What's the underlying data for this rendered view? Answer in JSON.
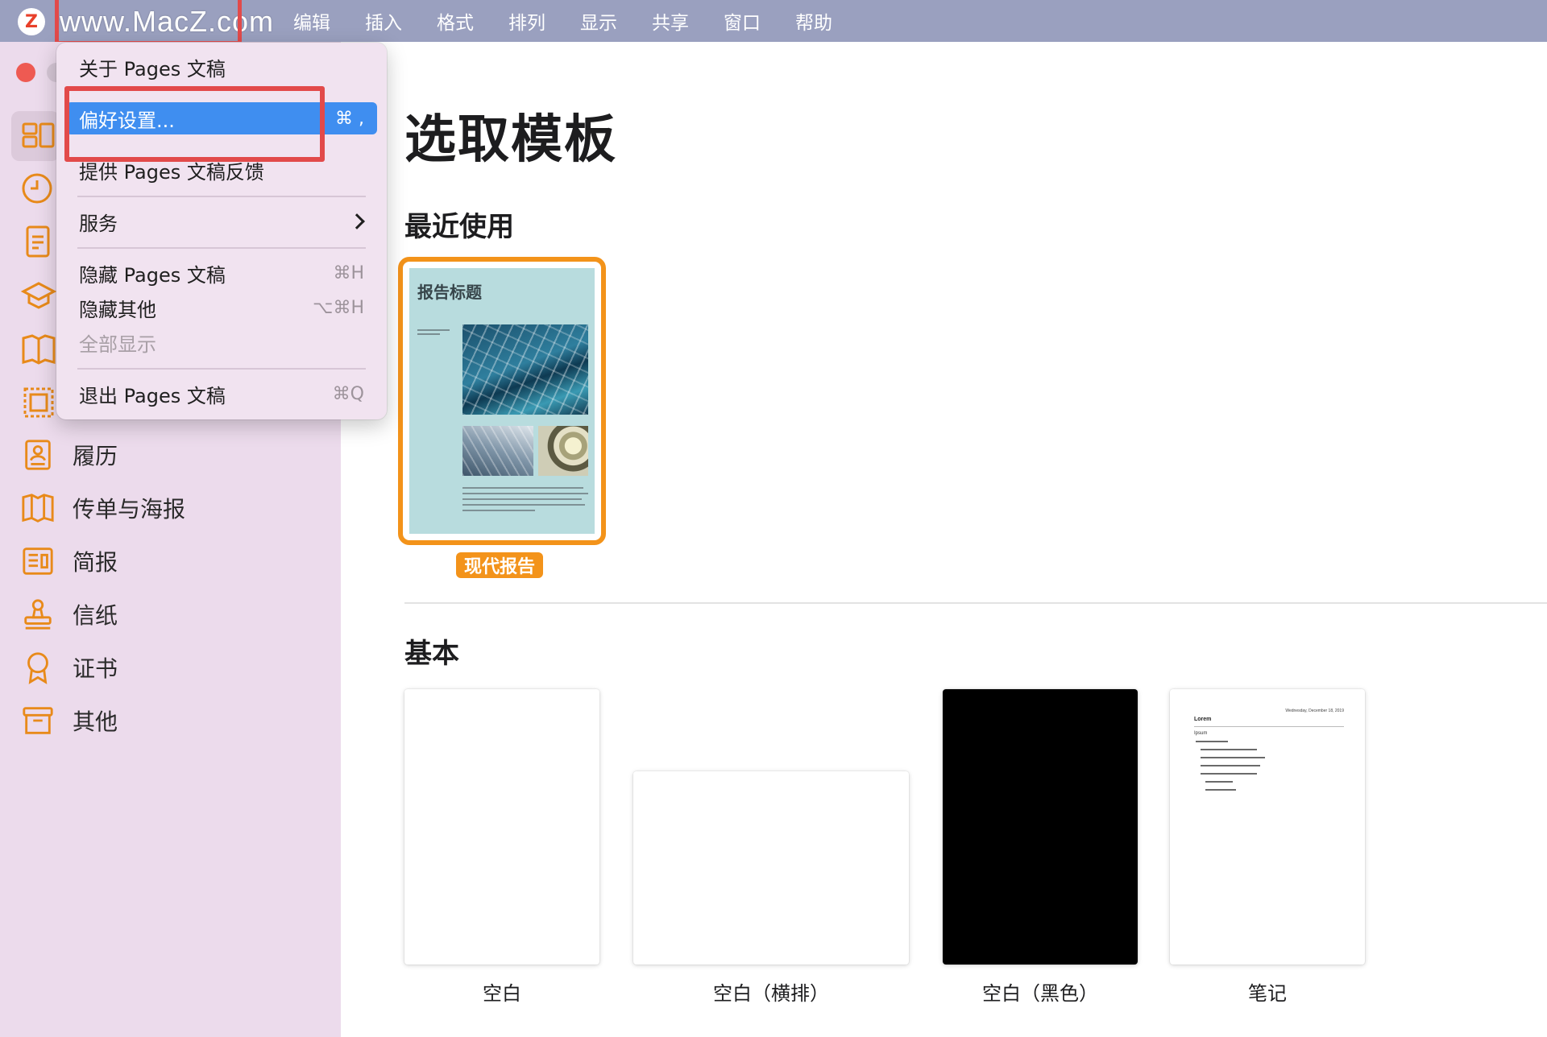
{
  "menubar": {
    "watermark": "www.MacZ.com",
    "menus": [
      "编辑",
      "插入",
      "格式",
      "排列",
      "显示",
      "共享",
      "窗口",
      "帮助"
    ]
  },
  "dropdown": {
    "about": "关于 Pages 文稿",
    "preferences": "偏好设置...",
    "preferences_shortcut": "⌘ ,",
    "feedback": "提供 Pages 文稿反馈",
    "services": "服务",
    "hide_pages": "隐藏 Pages 文稿",
    "hide_pages_shortcut": "⌘H",
    "hide_others": "隐藏其他",
    "hide_others_shortcut": "⌥⌘H",
    "show_all": "全部显示",
    "quit": "退出 Pages 文稿",
    "quit_shortcut": "⌘Q"
  },
  "sidebar": {
    "items": [
      {
        "label": "履历",
        "icon": "resume-icon"
      },
      {
        "label": "传单与海报",
        "icon": "flyer-icon"
      },
      {
        "label": "简报",
        "icon": "newsletter-icon"
      },
      {
        "label": "信纸",
        "icon": "stationery-icon"
      },
      {
        "label": "证书",
        "icon": "certificate-icon"
      },
      {
        "label": "其他",
        "icon": "archive-icon"
      }
    ]
  },
  "main": {
    "title": "选取模板",
    "recent_section": "最近使用",
    "recent_template": {
      "doc_title": "报告标题",
      "label": "现代报告"
    },
    "basic_section": "基本",
    "basic_templates": [
      {
        "label": "空白"
      },
      {
        "label": "空白（横排）"
      },
      {
        "label": "空白（黑色）"
      },
      {
        "label": "笔记",
        "preview_heading": "Lorem",
        "preview_sub": "Ipsum",
        "preview_date": "Wednesday, December 18, 2019"
      }
    ]
  },
  "colors": {
    "accent": "#f3931a",
    "selection": "#3f8ef0",
    "highlight_box": "#e24a4a",
    "sidebar_bg": "#ecdbec"
  }
}
